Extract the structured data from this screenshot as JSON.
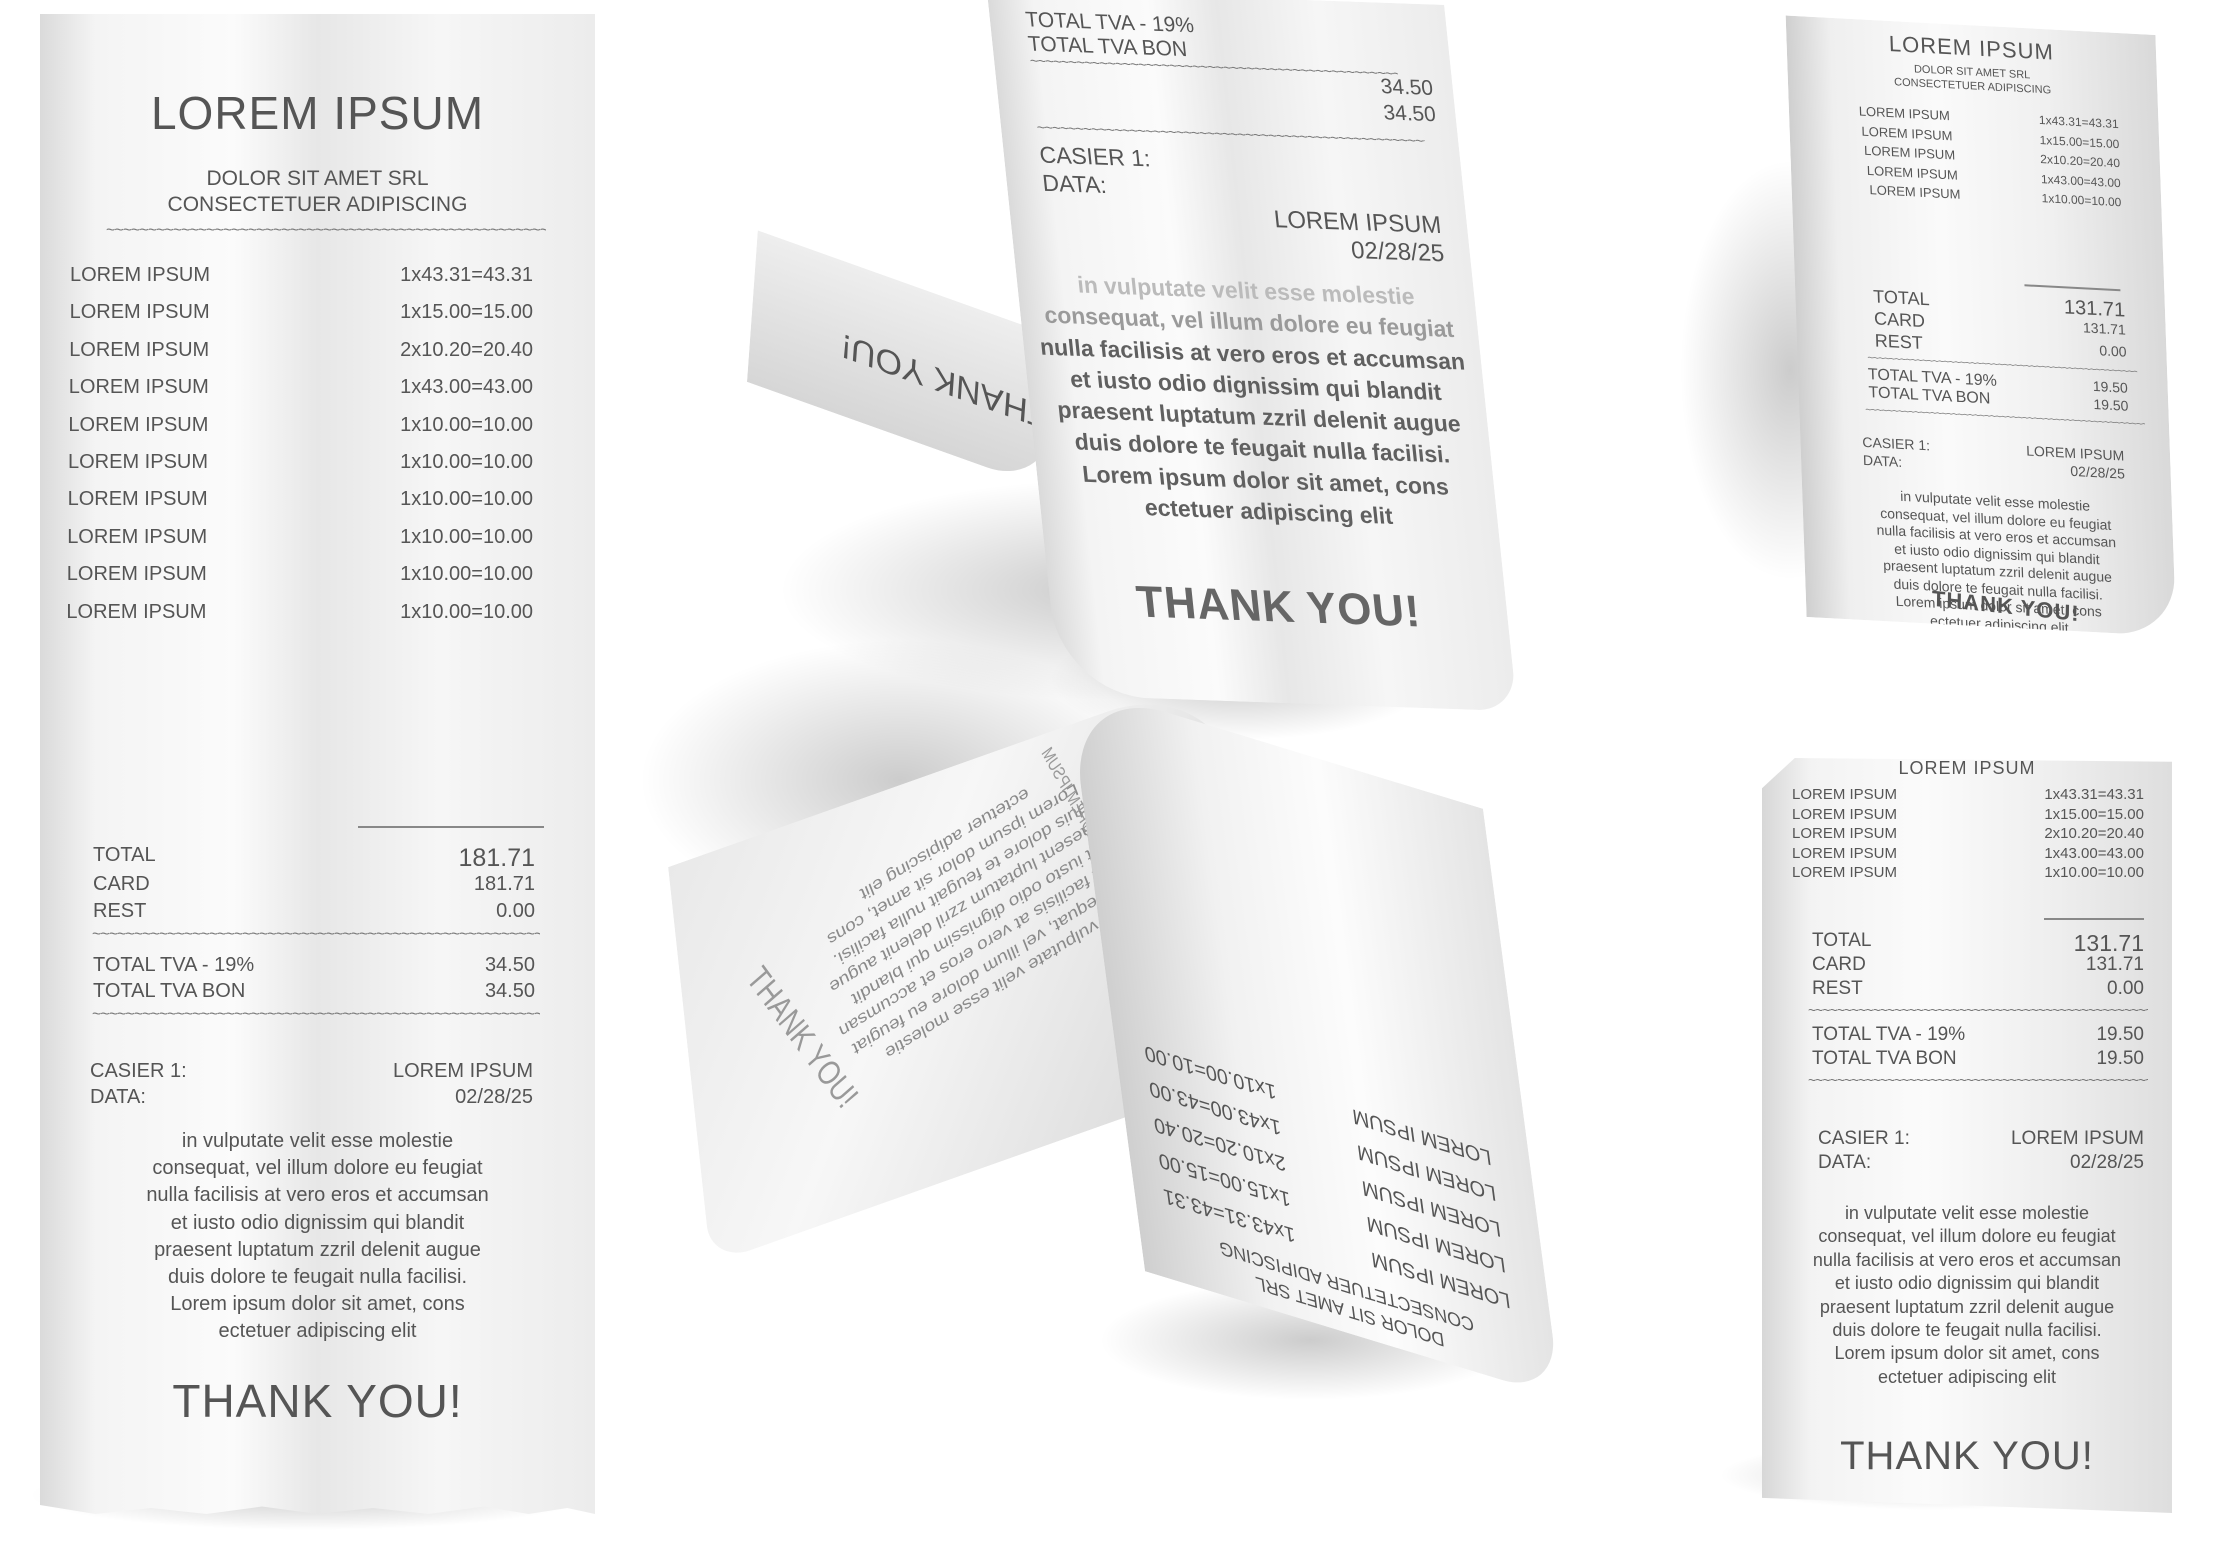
{
  "receipt": {
    "store_name": "LOREM IPSUM",
    "company_line1": "DOLOR SIT AMET SRL",
    "company_line2": "CONSECTETUER ADIPISCING",
    "separator": "~~~~~~~~~~~~~~~~~~~~~~~~~~~~~~~~~~~~~~~~~~~~~~~~~~~~~~~~~~~~~~~~~~~~~~~~~~~~~~~~~~~~~~~~~~~~~",
    "items_long": [
      {
        "name": "LOREM IPSUM",
        "calc": "1x43.31=43.31"
      },
      {
        "name": "LOREM IPSUM",
        "calc": "1x15.00=15.00"
      },
      {
        "name": "LOREM IPSUM",
        "calc": "2x10.20=20.40"
      },
      {
        "name": "LOREM IPSUM",
        "calc": "1x43.00=43.00"
      },
      {
        "name": "LOREM IPSUM",
        "calc": "1x10.00=10.00"
      },
      {
        "name": "LOREM IPSUM",
        "calc": "1x10.00=10.00"
      },
      {
        "name": "LOREM IPSUM",
        "calc": "1x10.00=10.00"
      },
      {
        "name": "LOREM IPSUM",
        "calc": "1x10.00=10.00"
      },
      {
        "name": "LOREM IPSUM",
        "calc": "1x10.00=10.00"
      },
      {
        "name": "LOREM IPSUM",
        "calc": "1x10.00=10.00"
      }
    ],
    "items_short": [
      {
        "name": "LOREM IPSUM",
        "calc": "1x43.31=43.31"
      },
      {
        "name": "LOREM IPSUM",
        "calc": "1x15.00=15.00"
      },
      {
        "name": "LOREM IPSUM",
        "calc": "2x10.20=20.40"
      },
      {
        "name": "LOREM IPSUM",
        "calc": "1x43.00=43.00"
      },
      {
        "name": "LOREM IPSUM",
        "calc": "1x10.00=10.00"
      }
    ],
    "total_label": "TOTAL",
    "card_label": "CARD",
    "rest_label": "REST",
    "long_total": "181.71",
    "long_card": "181.71",
    "short_total": "131.71",
    "short_card": "131.71",
    "rest_value": "0.00",
    "tva_label": "TOTAL TVA - 19%",
    "tva_bon_label": "TOTAL TVA BON",
    "long_tva": "34.50",
    "long_tva_bon": "34.50",
    "short_tva": "19.50",
    "short_tva_bon": "19.50",
    "casier_label": "CASIER 1:",
    "data_label": "DATA:",
    "casier_value": "LOREM IPSUM",
    "date_value": "02/28/25",
    "body_lines": [
      "in vulputate velit esse molestie",
      "consequat, vel illum dolore eu feugiat",
      "nulla facilisis at vero eros et accumsan",
      "et iusto odio dignissim qui blandit",
      "praesent luptatum zzril delenit augue",
      "duis dolore te feugait nulla facilisi.",
      "Lorem ipsum dolor sit amet, cons",
      "ectetuer adipiscing elit"
    ],
    "thanks": "THANK YOU!"
  }
}
